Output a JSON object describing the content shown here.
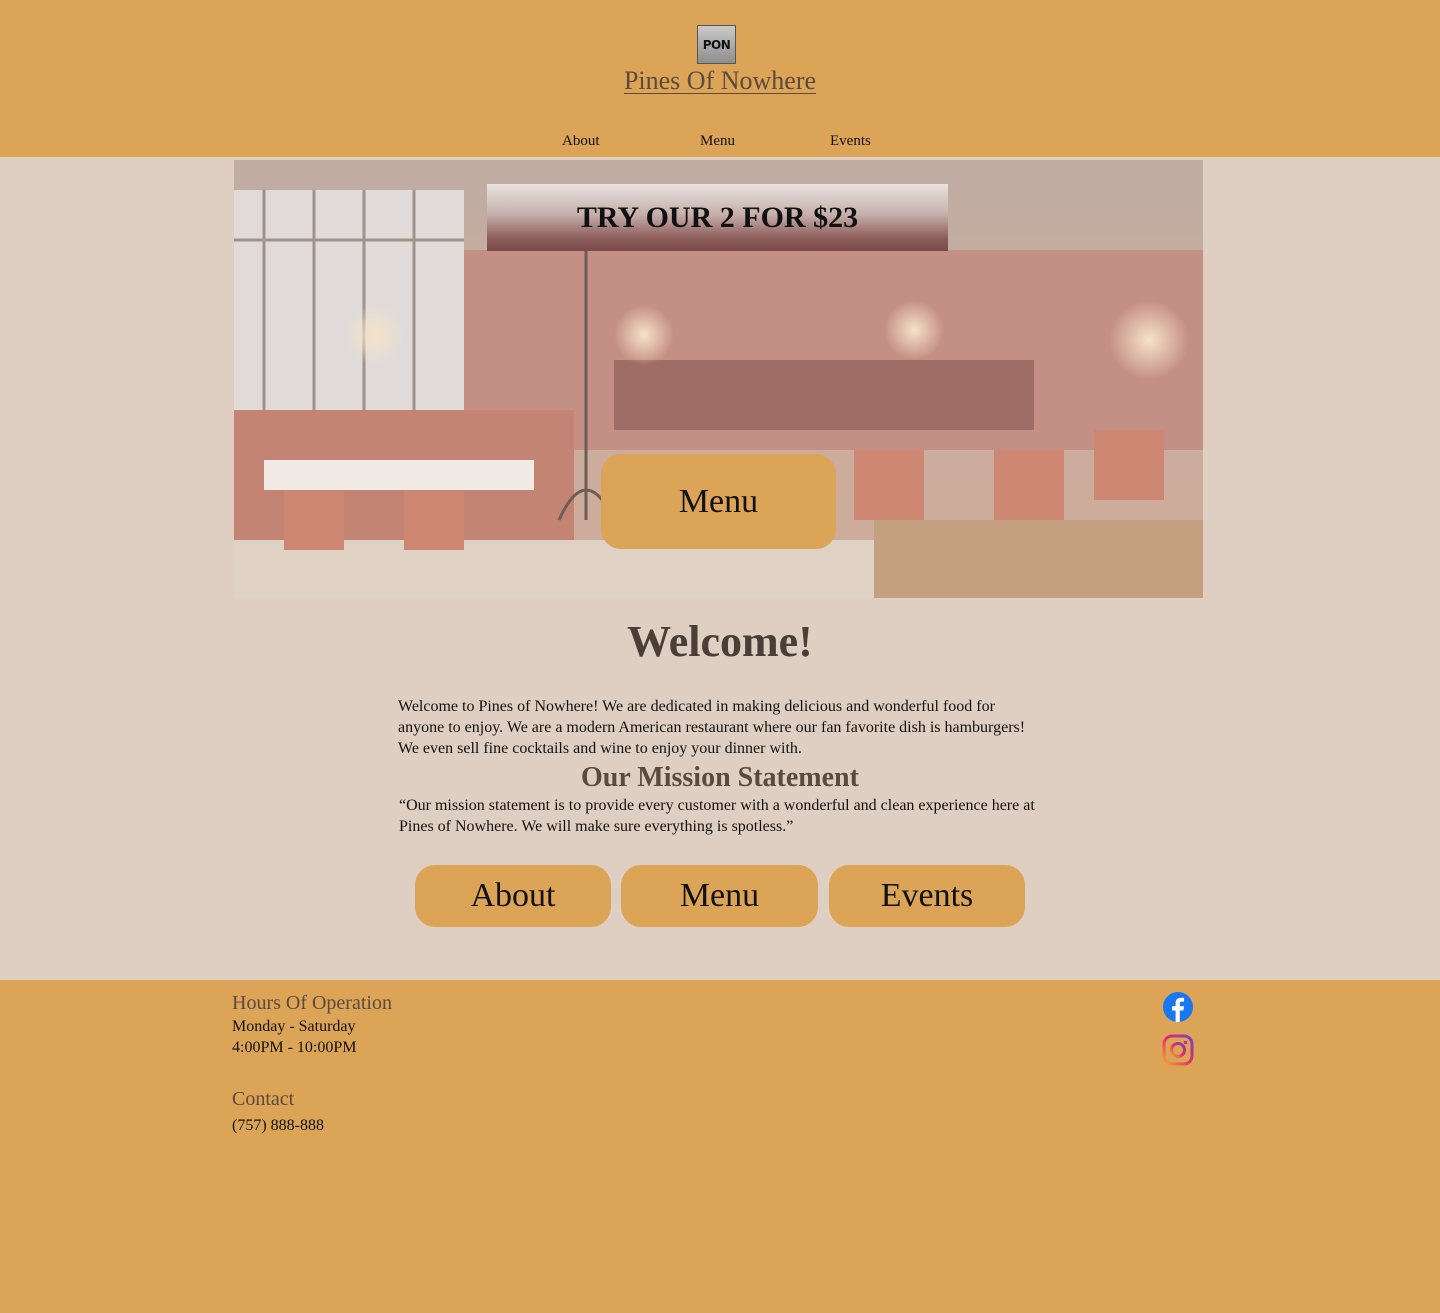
{
  "header": {
    "logo_text": "PON",
    "site_title": "Pines Of Nowhere",
    "nav": [
      "About",
      "Menu",
      "Events"
    ]
  },
  "hero": {
    "promo_text": "TRY OUR 2 FOR $23",
    "menu_button_label": "Menu"
  },
  "welcome": {
    "title": "Welcome!",
    "text": "Welcome to Pines of Nowhere! We are dedicated in making delicious and wonderful food for anyone to enjoy. We are a modern American restaurant where our fan favorite dish is hamburgers! We even sell fine cocktails and wine to enjoy your dinner with."
  },
  "mission": {
    "title": "Our Mission Statement",
    "text": "“Our mission statement is to provide every customer with a wonderful and clean experience here at Pines of Nowhere. We will make sure everything is spotless.”"
  },
  "page_buttons": [
    "About",
    "Menu",
    "Events"
  ],
  "footer": {
    "hours_heading": "Hours Of Operation",
    "hours_days": "Monday - Saturday",
    "hours_time": "4:00PM - 10:00PM",
    "contact_heading": "Contact",
    "contact_phone": "(757) 888-888",
    "social_icons": [
      "facebook-icon",
      "instagram-icon"
    ]
  },
  "colors": {
    "accent": "#dca456",
    "background": "#dfcfc2",
    "heading": "#4a3f38"
  }
}
